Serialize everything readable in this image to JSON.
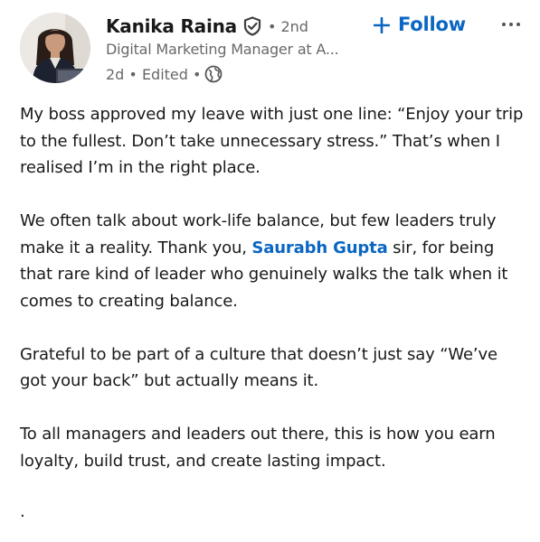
{
  "author": {
    "name": "Kanika Raina",
    "degree": "• 2nd",
    "headline": "Digital Marketing Manager at A...",
    "time": "2d • Edited •"
  },
  "actions": {
    "follow_label": "Follow",
    "follow_icon": "plus-icon",
    "more_icon": "ellipsis-icon"
  },
  "colors": {
    "accent": "#0a66c2",
    "text": "#1f1f1f",
    "muted": "#666666"
  },
  "post": {
    "p1": "My boss approved my leave with just one line: “Enjoy your trip to the fullest. Don’t take unnecessary stress.” That’s when I realised I’m in the right place.",
    "p2_before": "We often talk about work-life balance, but few leaders truly make it a reality. Thank you, ",
    "p2_mention": "Saurabh Gupta",
    "p2_after": " sir, for being that rare kind of leader who genuinely walks the talk when it comes to creating balance.",
    "p3": "Grateful to be part of a culture that doesn’t just say “We’ve got your back” but actually means it.",
    "p4": "To all managers and leaders out there, this is how you earn loyalty, build trust, and create lasting impact.",
    "trailing": "."
  }
}
